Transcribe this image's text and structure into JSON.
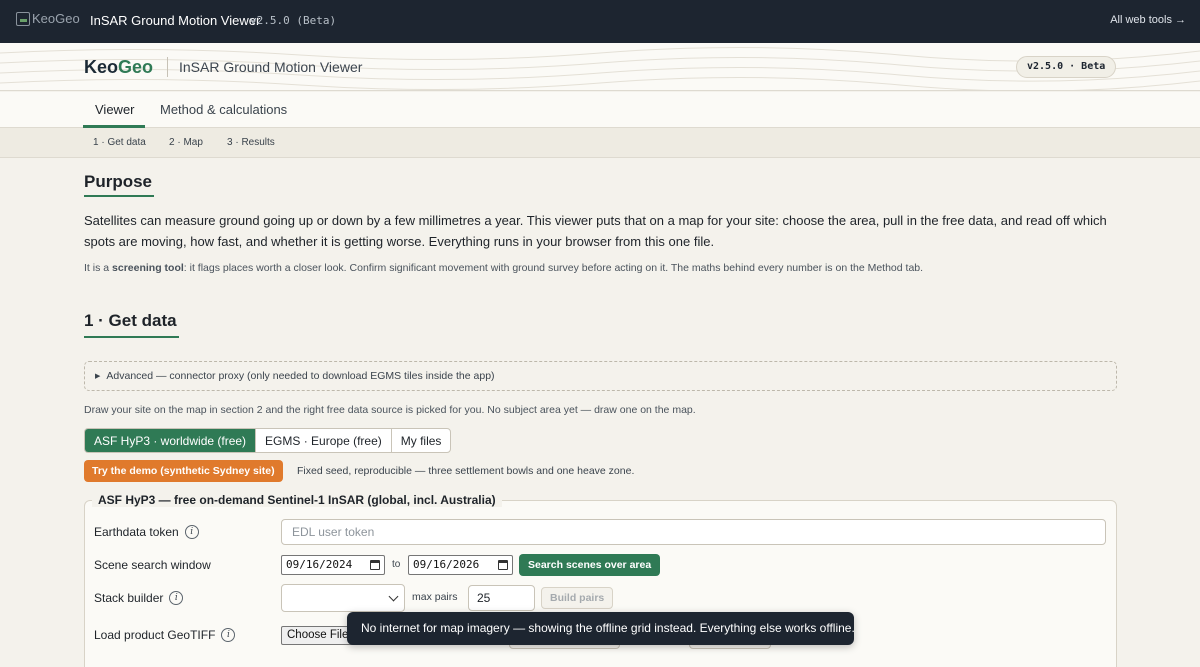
{
  "topbar": {
    "logo_alt": "KeoGeo",
    "title": "InSAR Ground Motion Viewer",
    "version": "v2.5.0 (Beta)",
    "all_tools": "All web tools →"
  },
  "brand": {
    "word_a": "Keo",
    "word_b": "Geo",
    "subtitle": "InSAR Ground Motion Viewer",
    "version_pill": "v2.5.0 · Beta"
  },
  "tabs": [
    {
      "label": "Viewer",
      "active": true
    },
    {
      "label": "Method & calculations",
      "active": false
    }
  ],
  "steps": [
    "1 · Get data",
    "2 · Map",
    "3 · Results"
  ],
  "purpose": {
    "heading": "Purpose",
    "body": "Satellites can measure ground going up or down by a few millimetres a year. This viewer puts that on a map for your site: choose the area, pull in the free data, and read off which spots are moving, how fast, and whether it is getting worse. Everything runs in your browser from this one file.",
    "note_pre": "It is a ",
    "note_bold": "screening tool",
    "note_post": ": it flags places worth a closer look. Confirm significant movement with ground survey before acting on it. The maths behind every number is on the Method tab."
  },
  "get_data": {
    "heading": "1 · Get data",
    "advanced": "Advanced — connector proxy (only needed to download EGMS tiles inside the app)",
    "instructions": "Draw your site on the map in section 2 and the right free data source is picked for you. No subject area yet — draw one on the map.",
    "sources": [
      {
        "label": "ASF HyP3 · worldwide (free)",
        "active": true
      },
      {
        "label": "EGMS · Europe (free)",
        "active": false
      },
      {
        "label": "My files",
        "active": false
      }
    ],
    "demo_button": "Try the demo (synthetic Sydney site)",
    "demo_note": "Fixed seed, reproducible — three settlement bowls and one heave zone.",
    "fieldset_legend": "ASF HyP3 — free on-demand Sentinel-1 InSAR (global, incl. Australia)",
    "token_label": "Earthdata token",
    "token_placeholder": "EDL user token",
    "window_label": "Scene search window",
    "date_from": "09/16/2024",
    "date_to_word": "to",
    "date_to": "09/16/2026",
    "search_button": "Search scenes over area",
    "stack_label": "Stack builder",
    "stack_select_value": "",
    "max_pairs_label": "max pairs",
    "max_pairs_value": "25",
    "build_button": "Build pairs",
    "load_label": "Load product GeoTIFF",
    "file_button": "Choose File"
  },
  "toast": "No internet for map imagery — showing the offline grid instead. Everything else works offline.",
  "colors": {
    "accent_green": "#2f7a55",
    "demo_orange": "#e07a2c",
    "dark_bar": "#1d2530"
  }
}
